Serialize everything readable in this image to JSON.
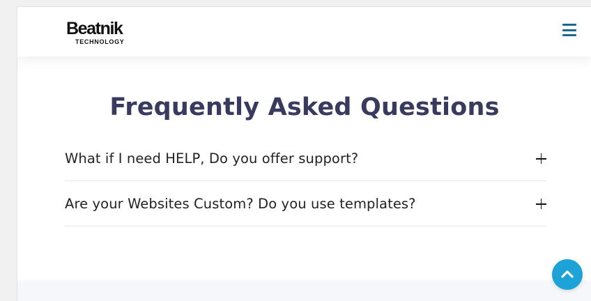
{
  "header": {
    "logo": {
      "word": "Beatnik",
      "sub": "TECHNOLOGY"
    },
    "menu_icon": "hamburger-menu-icon"
  },
  "faq": {
    "title": "Frequently Asked Questions",
    "items": [
      {
        "question": "What if I need HELP, Do you offer support?",
        "expanded": false,
        "icon": "plus-icon"
      },
      {
        "question": "Are your Websites Custom? Do you use templates?",
        "expanded": false,
        "icon": "plus-icon"
      }
    ]
  },
  "scroll_top": {
    "icon": "chevron-up-icon"
  },
  "colors": {
    "title": "#383a5e",
    "menu": "#1a6a90",
    "scroll_button": "#1ea3d9",
    "footer_strip": "#f5f7fb"
  }
}
